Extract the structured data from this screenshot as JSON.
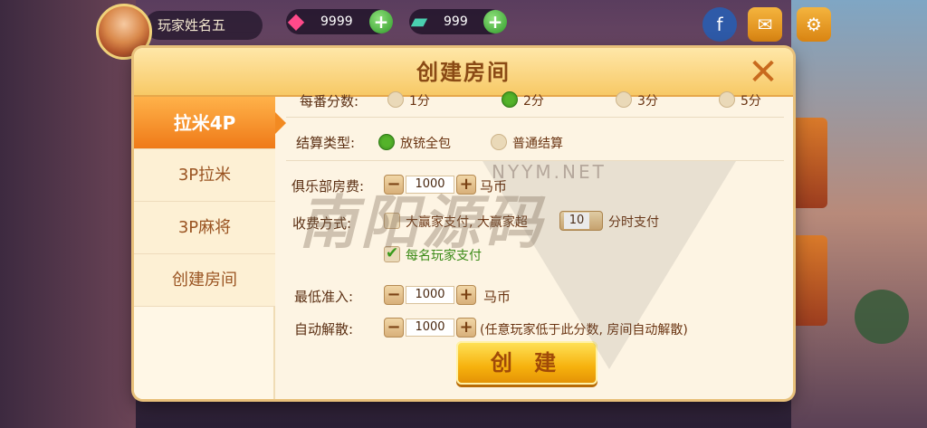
{
  "topbar": {
    "player_name": "玩家姓名五",
    "gems": "9999",
    "cards": "999"
  },
  "dialog": {
    "title": "创建房间",
    "close": "✕"
  },
  "sidebar": {
    "items": [
      {
        "label": "拉米4P",
        "active": true
      },
      {
        "label": "3P拉米",
        "active": false
      },
      {
        "label": "3P麻将",
        "active": false
      },
      {
        "label": "创建房间",
        "active": false
      }
    ]
  },
  "form": {
    "base_score": {
      "label": "每番分数:",
      "options": [
        "1分",
        "2分",
        "3分",
        "5分"
      ],
      "selected": 1
    },
    "settlement": {
      "label": "结算类型:",
      "options": [
        "放铳全包",
        "普通结算"
      ],
      "selected": 0
    },
    "club_fee": {
      "label": "俱乐部房费:",
      "value": "1000",
      "unit": "马币"
    },
    "charge_mode": {
      "label": "收费方式:",
      "option1_text": "大赢家支付, 大赢家超",
      "option1_input": "10",
      "option1_suffix": "分时支付",
      "option2_text": "每名玩家支付",
      "option1_checked": false,
      "option2_checked": true
    },
    "min_entry": {
      "label": "最低准入:",
      "value": "1000",
      "unit": "马币"
    },
    "auto_dissolve": {
      "label": "自动解散:",
      "value": "1000",
      "note": "(任意玩家低于此分数, 房间自动解散)"
    },
    "create_button": "创 建"
  },
  "watermark": {
    "url": "NYYM.NET",
    "text": "南阳源码"
  },
  "colors": {
    "accent": "#f28a22",
    "title": "#8a4a15",
    "button": "#f6b10d"
  }
}
